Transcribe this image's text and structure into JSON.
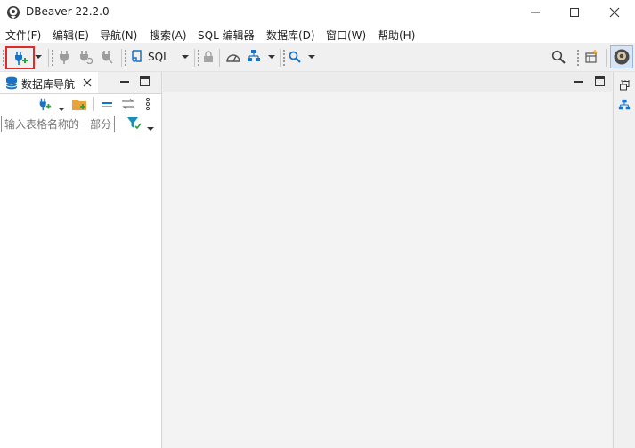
{
  "window": {
    "title": "DBeaver 22.2.0"
  },
  "menu": {
    "items": [
      "文件(F)",
      "编辑(E)",
      "导航(N)",
      "搜索(A)",
      "SQL 编辑器",
      "数据库(D)",
      "窗口(W)",
      "帮助(H)"
    ]
  },
  "toolbar": {
    "sql_label": "SQL"
  },
  "navigator": {
    "tab_label": "数据库导航",
    "filter_placeholder": "输入表格名称的一部分"
  },
  "colors": {
    "accent_blue": "#1673c7",
    "highlight_red": "#e02b2b",
    "folder_orange": "#e8a33a"
  },
  "icons": [
    "dbeaver-logo-icon",
    "minimize-icon",
    "maximize-icon",
    "close-icon",
    "new-connection-plug-icon",
    "dropdown-arrow-icon",
    "connect-icon",
    "reconnect-icon",
    "disconnect-icon",
    "sql-editor-icon",
    "lock-icon",
    "dashboard-gauge-icon",
    "schema-compare-icon",
    "search-icon",
    "global-search-icon",
    "perspective-icon",
    "user-avatar-icon",
    "database-stack-icon",
    "new-folder-icon",
    "collapse-all-icon",
    "link-editor-icon",
    "view-menu-icon",
    "filter-icon"
  ]
}
